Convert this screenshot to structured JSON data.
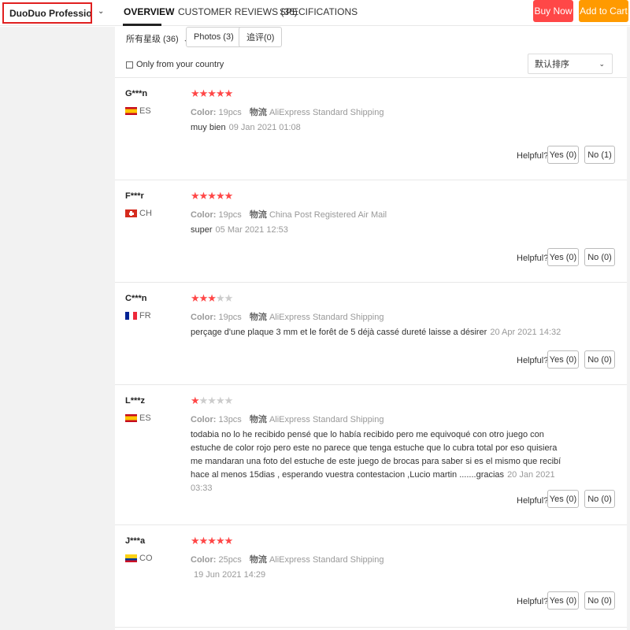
{
  "header": {
    "store_name": "DuoDuo Profession...",
    "tabs": [
      {
        "label": "OVERVIEW",
        "active": true
      },
      {
        "label": "CUSTOMER REVIEWS (36)",
        "active": false
      },
      {
        "label": "SPECIFICATIONS",
        "active": false
      }
    ],
    "buy_now": "Buy Now",
    "add_to_cart": "Add to Cart"
  },
  "filters": {
    "rating_select": "所有星级 (36)",
    "photos": "Photos (3)",
    "additional": "追评(0)",
    "only_country": "Only from your country",
    "sort": "默认排序"
  },
  "labels": {
    "color": "Color:",
    "shipping": "物流",
    "helpful": "Helpful?"
  },
  "reviews": [
    {
      "name": "G***n",
      "country": "ES",
      "rating": 5,
      "color": "19pcs",
      "shipping": "AliExpress Standard Shipping",
      "text": "muy bien",
      "date": "09 Jan 2021 01:08",
      "yes": "Yes (0)",
      "no": "No (1)"
    },
    {
      "name": "F***r",
      "country": "CH",
      "rating": 5,
      "color": "19pcs",
      "shipping": "China Post Registered Air Mail",
      "text": "super",
      "date": "05 Mar 2021 12:53",
      "yes": "Yes (0)",
      "no": "No (0)"
    },
    {
      "name": "C***n",
      "country": "FR",
      "rating": 3,
      "color": "19pcs",
      "shipping": "AliExpress Standard Shipping",
      "text": "perçage d'une plaque 3 mm et le forêt de 5 déjà cassé dureté laisse a désirer",
      "date": "20 Apr 2021 14:32",
      "yes": "Yes (0)",
      "no": "No (0)"
    },
    {
      "name": "L***z",
      "country": "ES",
      "rating": 1,
      "color": "13pcs",
      "shipping": "AliExpress Standard Shipping",
      "text": "todabia no lo he recibido pensé que lo había recibido pero me equivoqué con otro juego con estuche de color rojo pero este no parece que tenga estuche que lo cubra total por eso quisiera me mandaran una foto del estuche de este juego de brocas para saber si es el mismo que recibí hace al menos 15dias , esperando vuestra contestacion ,Lucio martin .......gracias",
      "date": "20 Jan 2021 03:33",
      "yes": "Yes (0)",
      "no": "No (0)"
    },
    {
      "name": "J***a",
      "country": "CO",
      "rating": 5,
      "color": "25pcs",
      "shipping": "AliExpress Standard Shipping",
      "text": "",
      "date": "19 Jun 2021 14:29",
      "yes": "Yes (0)",
      "no": "No (0)"
    }
  ],
  "colors": {
    "accent_red": "#ff4747",
    "accent_orange": "#ff9a00",
    "store_border": "#e02020"
  }
}
